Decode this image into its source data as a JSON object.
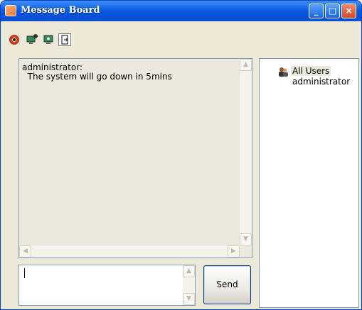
{
  "window": {
    "title": "Message Board",
    "controls": {
      "minimize": "_",
      "maximize": "□",
      "close": "×"
    }
  },
  "toolbar": {
    "tools": [
      {
        "name": "status-icon",
        "color": "#c0392b"
      },
      {
        "name": "computer-user-icon",
        "color": "#2e8b57"
      },
      {
        "name": "monitor-icon",
        "color": "#2e8b57"
      },
      {
        "name": "exit-door-icon",
        "color": "#333333"
      }
    ]
  },
  "messages": {
    "sender": "administrator:",
    "text": "  The system will go down in 5mins",
    "scroll": {
      "up": "▲",
      "down": "▼",
      "left": "◀",
      "right": "▶"
    }
  },
  "users": {
    "group_label": "All Users",
    "items": [
      "administrator"
    ]
  },
  "compose": {
    "value": "",
    "send_label": "Send"
  },
  "colors": {
    "titlebar": "#0a5fe6",
    "window_bg": "#ece9d8",
    "message_bg": "#ebe9de",
    "border": "#7f9db9"
  }
}
